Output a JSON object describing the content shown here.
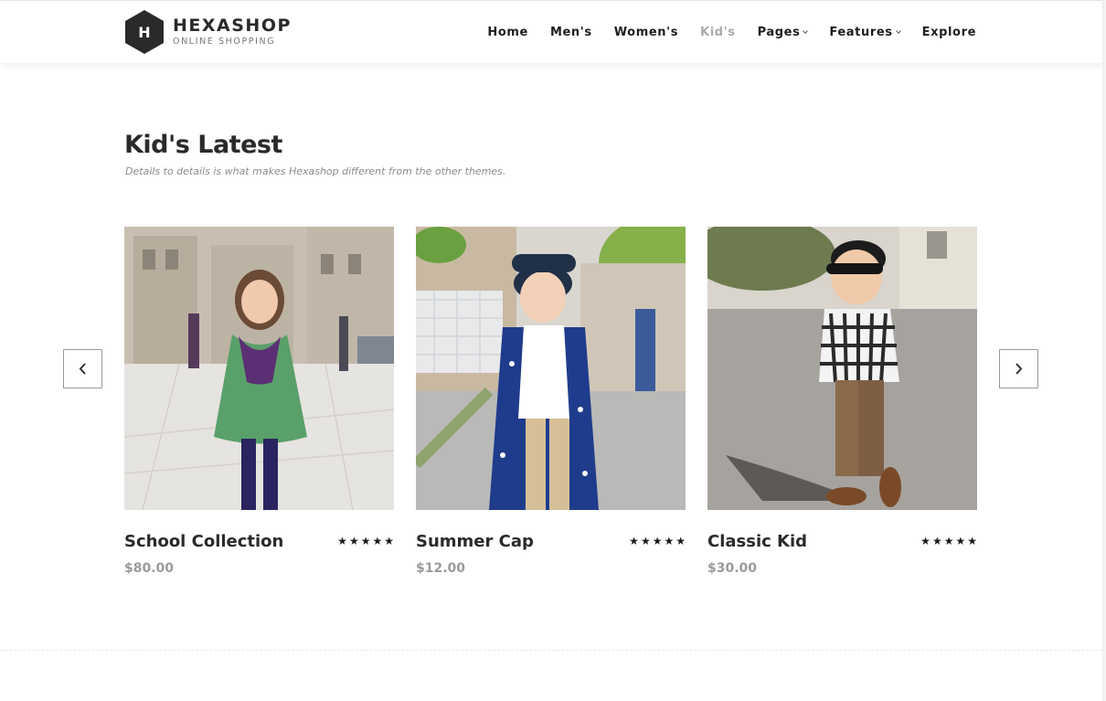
{
  "brand": {
    "name": "HEXASHOP",
    "tagline": "ONLINE SHOPPING",
    "mark": "H"
  },
  "nav": {
    "items": [
      {
        "label": "Home",
        "active": false,
        "dropdown": false
      },
      {
        "label": "Men's",
        "active": false,
        "dropdown": false
      },
      {
        "label": "Women's",
        "active": false,
        "dropdown": false
      },
      {
        "label": "Kid's",
        "active": true,
        "dropdown": false
      },
      {
        "label": "Pages",
        "active": false,
        "dropdown": true
      },
      {
        "label": "Features",
        "active": false,
        "dropdown": true
      },
      {
        "label": "Explore",
        "active": false,
        "dropdown": false
      }
    ]
  },
  "section": {
    "title": "Kid's Latest",
    "subtitle": "Details to details is what makes Hexashop different from the other themes."
  },
  "carousel": {
    "prev_icon": "chevron-left-icon",
    "next_icon": "chevron-right-icon"
  },
  "products": [
    {
      "title": "School Collection",
      "price": "$80.00",
      "rating": 5
    },
    {
      "title": "Summer Cap",
      "price": "$12.00",
      "rating": 5
    },
    {
      "title": "Classic Kid",
      "price": "$30.00",
      "rating": 5
    }
  ],
  "colors": {
    "text_dark": "#2a2a2a",
    "nav_active": "#aaaaaa",
    "price": "#9a9a9a",
    "logo_hex": "#2a2a2a"
  }
}
